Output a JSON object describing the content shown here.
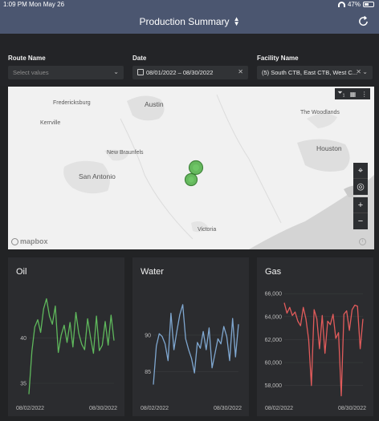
{
  "status_bar": {
    "time_date": "1:09 PM   Mon May 26",
    "battery": "47%"
  },
  "header": {
    "title": "Production Summary"
  },
  "filters": {
    "route": {
      "label": "Route Name",
      "placeholder": "Select values"
    },
    "date": {
      "label": "Date",
      "value": "08/01/2022 – 08/30/2022"
    },
    "facility": {
      "label": "Facility Name",
      "value": "(5) South CTB, East CTB, West C..."
    }
  },
  "map": {
    "cities": [
      "Fredericksburg",
      "Austin",
      "Kerrville",
      "New Braunfels",
      "San Antonio",
      "Victoria",
      "The Woodlands",
      "Houston"
    ],
    "brand": "mapbox",
    "filter_badge": "1",
    "zoom_in": "+",
    "zoom_out": "−",
    "info": "i"
  },
  "chart_data": [
    {
      "type": "line",
      "title": "Oil",
      "color": "#5fb85c",
      "xlabels": [
        "08/02/2022",
        "08/30/2022"
      ],
      "ylim": [
        33.5,
        45.5
      ],
      "yticks": [
        35,
        40
      ],
      "values": [
        33.8,
        38.5,
        41.2,
        42.0,
        40.6,
        43.2,
        44.3,
        42.4,
        41.5,
        43.5,
        38.4,
        40.3,
        41.4,
        39.5,
        41.7,
        39.0,
        42.8,
        40.5,
        39.3,
        38.7,
        42.1,
        40.0,
        38.3,
        42.4,
        38.6,
        39.2,
        41.8,
        39.2,
        42.5,
        39.7
      ]
    },
    {
      "type": "line",
      "title": "Water",
      "color": "#7fa7d0",
      "xlabels": [
        "08/02/2022",
        "08/30/2022"
      ],
      "ylim": [
        81.5,
        96.5
      ],
      "yticks": [
        85,
        90
      ],
      "values": [
        83.2,
        88.5,
        90.2,
        89.8,
        88.8,
        86.5,
        93.0,
        88.0,
        90.5,
        92.8,
        94.2,
        89.5,
        88.0,
        86.8,
        84.8,
        89.0,
        88.2,
        90.5,
        88.0,
        91.0,
        85.5,
        87.5,
        89.5,
        88.8,
        91.2,
        89.8,
        86.5,
        92.3,
        87.0,
        91.5
      ]
    },
    {
      "type": "line",
      "title": "Gas",
      "color": "#e25b5b",
      "xlabels": [
        "08/02/2022",
        "08/30/2022"
      ],
      "ylim": [
        57000,
        66500
      ],
      "yticks": [
        58000,
        60000,
        62000,
        64000,
        66000
      ],
      "ytick_labels": [
        "58,000",
        "60,000",
        "62,000",
        "64,000",
        "66,000"
      ],
      "values": [
        65200,
        64300,
        64800,
        64100,
        64400,
        63600,
        63200,
        64800,
        63800,
        62000,
        58000,
        64600,
        63800,
        61200,
        64100,
        60800,
        63600,
        63300,
        64200,
        62100,
        62600,
        57100,
        64200,
        64500,
        62800,
        64600,
        65000,
        64900,
        61200,
        63800
      ]
    }
  ]
}
